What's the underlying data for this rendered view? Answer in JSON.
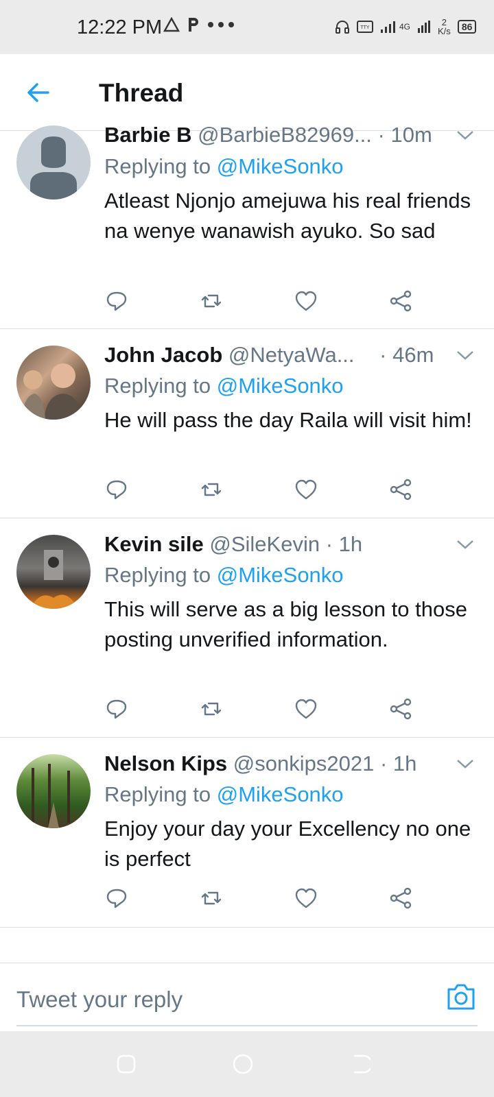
{
  "status_bar": {
    "time": "12:22 PM",
    "left_icons": [
      "warning-triangle-icon",
      "p-icon",
      "more-dots-icon"
    ],
    "network": "4G",
    "speed_value": "2",
    "speed_unit": "K/s",
    "battery": "86"
  },
  "header": {
    "title": "Thread"
  },
  "tweets": [
    {
      "name": "Barbie B",
      "handle": "@BarbieB82969...",
      "time": "· 10m",
      "replying_prefix": "Replying to ",
      "replying_to": "@MikeSonko",
      "text": "Atleast Njonjo amejuwa his real friends na wenye wanawish ayuko. So sad"
    },
    {
      "name": "John Jacob",
      "handle": "@NetyaWa...",
      "time": "· 46m",
      "replying_prefix": "Replying to ",
      "replying_to": "@MikeSonko",
      "text": "He will pass the day Raila will visit him!"
    },
    {
      "name": "Kevin sile",
      "handle": "@SileKevin",
      "time": "· 1h",
      "replying_prefix": "Replying to ",
      "replying_to": "@MikeSonko",
      "text": "This will serve as a big lesson to those posting unverified information."
    },
    {
      "name": "Nelson Kips",
      "handle": "@sonkips2021",
      "time": "· 1h",
      "replying_prefix": "Replying to ",
      "replying_to": "@MikeSonko",
      "text": "Enjoy your day your Excellency no one is perfect"
    }
  ],
  "composer": {
    "placeholder": "Tweet your reply"
  },
  "colors": {
    "accent": "#1da1f2",
    "secondary_text": "#657786",
    "divider": "#dcdfe3"
  }
}
